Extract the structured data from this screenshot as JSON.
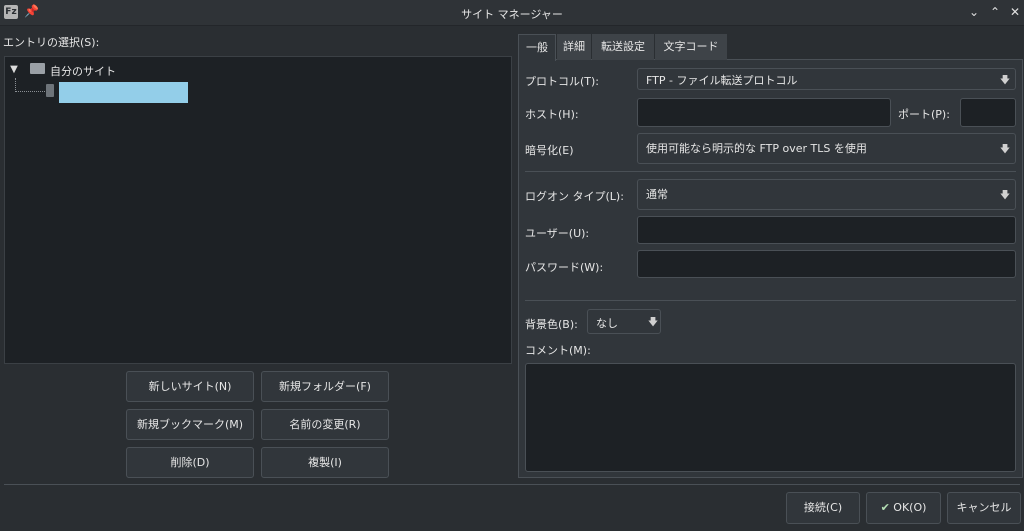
{
  "window": {
    "title": "サイト マネージャー",
    "app_icon_text": "Fz",
    "pin_icon": "📌",
    "minimize_icon": "⌄",
    "maximize_icon": "⌃",
    "close_icon": "✕"
  },
  "tree": {
    "label": "エントリの選択(S):",
    "root": {
      "label": "自分のサイト",
      "expander": "▼"
    }
  },
  "left_buttons": {
    "new_site": "新しいサイト(N)",
    "new_folder": "新規フォルダー(F)",
    "new_bookmark": "新規ブックマーク(M)",
    "rename": "名前の変更(R)",
    "delete": "削除(D)",
    "duplicate": "複製(I)"
  },
  "tabs": {
    "general": "一般",
    "advanced": "詳細",
    "transfer": "転送設定",
    "charset": "文字コード"
  },
  "form": {
    "protocol_label": "プロトコル(T):",
    "protocol_value": "FTP - ファイル転送プロトコル",
    "host_label": "ホスト(H):",
    "host_value": "",
    "port_label": "ポート(P):",
    "port_value": "",
    "encryption_label": "暗号化(E)",
    "encryption_value": "使用可能なら明示的な FTP over TLS を使用",
    "logon_label": "ログオン タイプ(L):",
    "logon_value": "通常",
    "user_label": "ユーザー(U):",
    "user_value": "",
    "password_label": "パスワード(W):",
    "password_value": "",
    "bgcolor_label": "背景色(B):",
    "bgcolor_value": "なし",
    "comment_label": "コメント(M):",
    "comment_value": "",
    "combo_arrow": "🡇"
  },
  "bottom_buttons": {
    "connect": "接続(C)",
    "ok": "OK(O)",
    "ok_icon": "✔",
    "cancel": "キャンセル"
  }
}
